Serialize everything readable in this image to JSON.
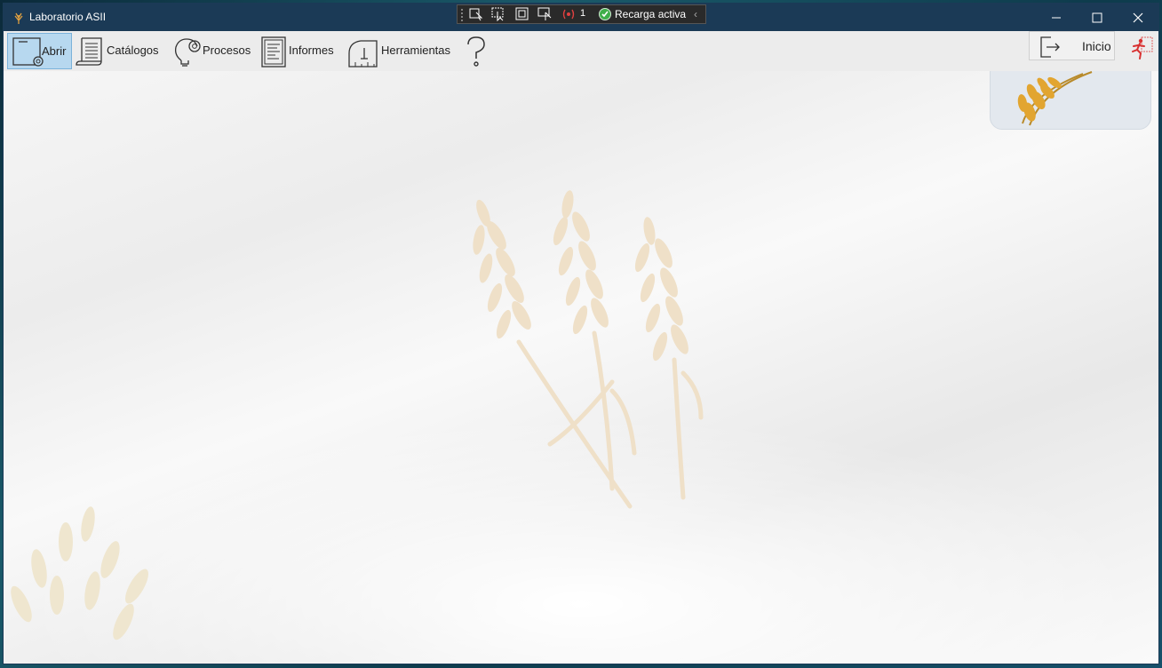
{
  "window": {
    "title": "Laboratorio ASII"
  },
  "debug_toolbar": {
    "change_count": "1",
    "status": "Recarga activa",
    "collapse_glyph": "‹"
  },
  "toolbar": {
    "items": [
      {
        "label": "Abrir"
      },
      {
        "label": "Catálogos"
      },
      {
        "label": "Procesos"
      },
      {
        "label": "Informes"
      },
      {
        "label": "Herramientas"
      }
    ],
    "help_icon": "question-icon",
    "inicio_label": "Inicio"
  },
  "colors": {
    "titlebar": "#1b3a56",
    "accent_selected": "#b7d8ef",
    "wheat": "#e8d2b0",
    "status_ok": "#3fae49"
  }
}
